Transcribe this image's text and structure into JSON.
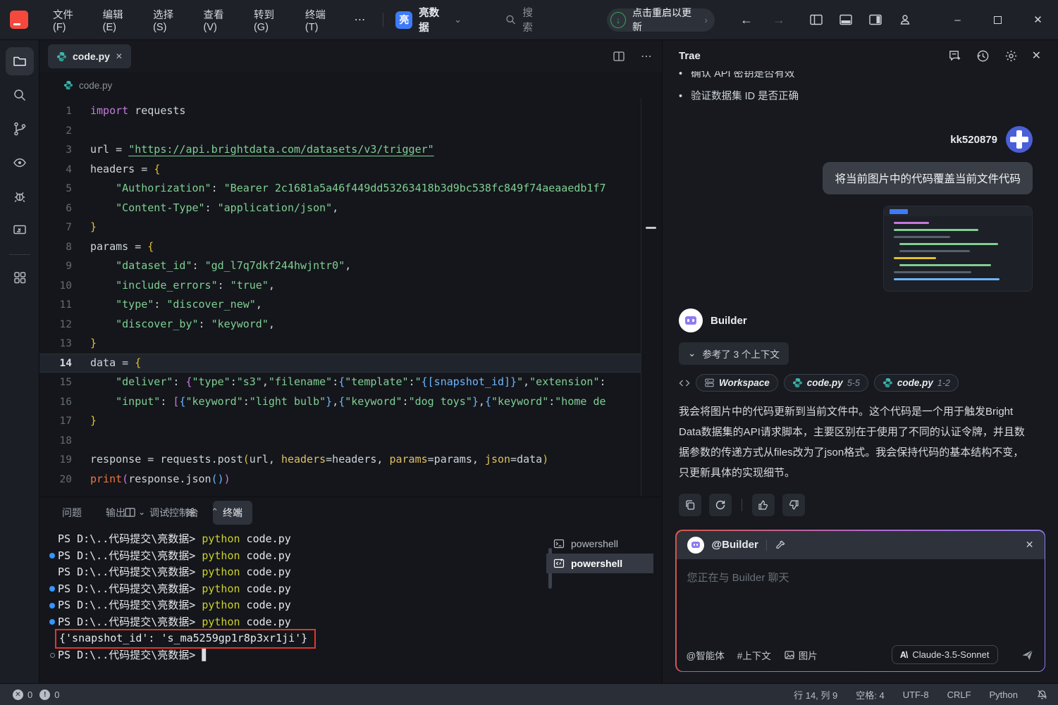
{
  "icons": {
    "close": "✕",
    "more": "⋯",
    "chevron_down": "⌄",
    "chevron_right": "›",
    "chevron_up": "⌃",
    "back": "←",
    "forward": "→",
    "minimize": "–",
    "down_arrow": "↓",
    "cursor": "▋",
    "divider": "|"
  },
  "titlebar": {
    "menus": [
      "文件(F)",
      "编辑(E)",
      "选择(S)",
      "查看(V)",
      "转到(G)",
      "终端(T)"
    ],
    "project_badge": "亮",
    "project_name": "亮数据",
    "search_label": "搜索",
    "update_label": "点击重启以更新"
  },
  "editor": {
    "tab_label": "code.py",
    "breadcrumb": "code.py",
    "lines": [
      {
        "n": 1,
        "segs": [
          [
            "kw",
            "import"
          ],
          [
            "pl",
            " requests"
          ]
        ]
      },
      {
        "n": 2,
        "segs": []
      },
      {
        "n": 3,
        "segs": [
          [
            "pl",
            "url = "
          ],
          [
            "strU",
            "\"https://api.brightdata.com/datasets/v3/trigger\""
          ]
        ]
      },
      {
        "n": 4,
        "segs": [
          [
            "pl",
            "headers = "
          ],
          [
            "y",
            "{"
          ]
        ]
      },
      {
        "n": 5,
        "segs": [
          [
            "pl",
            "    "
          ],
          [
            "str",
            "\"Authorization\""
          ],
          [
            "pl",
            ": "
          ],
          [
            "str",
            "\"Bearer 2c1681a5a46f449dd53263418b3d9bc538fc849f74aeaaedb1f7"
          ]
        ]
      },
      {
        "n": 6,
        "segs": [
          [
            "pl",
            "    "
          ],
          [
            "str",
            "\"Content-Type\""
          ],
          [
            "pl",
            ": "
          ],
          [
            "str",
            "\"application/json\""
          ],
          [
            "pl",
            ","
          ]
        ]
      },
      {
        "n": 7,
        "segs": [
          [
            "y",
            "}"
          ]
        ]
      },
      {
        "n": 8,
        "segs": [
          [
            "pl",
            "params = "
          ],
          [
            "y",
            "{"
          ]
        ]
      },
      {
        "n": 9,
        "segs": [
          [
            "pl",
            "    "
          ],
          [
            "str",
            "\"dataset_id\""
          ],
          [
            "pl",
            ": "
          ],
          [
            "str",
            "\"gd_l7q7dkf244hwjntr0\""
          ],
          [
            "pl",
            ","
          ]
        ]
      },
      {
        "n": 10,
        "segs": [
          [
            "pl",
            "    "
          ],
          [
            "str",
            "\"include_errors\""
          ],
          [
            "pl",
            ": "
          ],
          [
            "str",
            "\"true\""
          ],
          [
            "pl",
            ","
          ]
        ]
      },
      {
        "n": 11,
        "segs": [
          [
            "pl",
            "    "
          ],
          [
            "str",
            "\"type\""
          ],
          [
            "pl",
            ": "
          ],
          [
            "str",
            "\"discover_new\""
          ],
          [
            "pl",
            ","
          ]
        ]
      },
      {
        "n": 12,
        "segs": [
          [
            "pl",
            "    "
          ],
          [
            "str",
            "\"discover_by\""
          ],
          [
            "pl",
            ": "
          ],
          [
            "str",
            "\"keyword\""
          ],
          [
            "pl",
            ","
          ]
        ]
      },
      {
        "n": 13,
        "segs": [
          [
            "y",
            "}"
          ]
        ]
      },
      {
        "n": 14,
        "current": true,
        "segs": [
          [
            "pl",
            "data = "
          ],
          [
            "y",
            "{"
          ]
        ]
      },
      {
        "n": 15,
        "segs": [
          [
            "pl",
            "    "
          ],
          [
            "str",
            "\"deliver\""
          ],
          [
            "pl",
            ": "
          ],
          [
            "p",
            "{"
          ],
          [
            "str",
            "\"type\""
          ],
          [
            "pl",
            ":"
          ],
          [
            "str",
            "\"s3\""
          ],
          [
            "pl",
            ","
          ],
          [
            "str",
            "\"filename\""
          ],
          [
            "pl",
            ":"
          ],
          [
            "b",
            "{"
          ],
          [
            "str",
            "\"template\""
          ],
          [
            "pl",
            ":"
          ],
          [
            "str",
            "\""
          ],
          [
            "b",
            "{[snapshot_id]}"
          ],
          [
            "str",
            "\""
          ],
          [
            "pl",
            ","
          ],
          [
            "str",
            "\"extension\""
          ],
          [
            "pl",
            ":"
          ]
        ]
      },
      {
        "n": 16,
        "segs": [
          [
            "pl",
            "    "
          ],
          [
            "str",
            "\"input\""
          ],
          [
            "pl",
            ": "
          ],
          [
            "p",
            "["
          ],
          [
            "b",
            "{"
          ],
          [
            "str",
            "\"keyword\""
          ],
          [
            "pl",
            ":"
          ],
          [
            "str",
            "\"light bulb\""
          ],
          [
            "b",
            "}"
          ],
          [
            "pl",
            ","
          ],
          [
            "b",
            "{"
          ],
          [
            "str",
            "\"keyword\""
          ],
          [
            "pl",
            ":"
          ],
          [
            "str",
            "\"dog toys\""
          ],
          [
            "b",
            "}"
          ],
          [
            "pl",
            ","
          ],
          [
            "b",
            "{"
          ],
          [
            "str",
            "\"keyword\""
          ],
          [
            "pl",
            ":"
          ],
          [
            "str",
            "\"home de"
          ]
        ]
      },
      {
        "n": 17,
        "segs": [
          [
            "y",
            "}"
          ]
        ]
      },
      {
        "n": 18,
        "segs": []
      },
      {
        "n": 19,
        "segs": [
          [
            "pl",
            "response = requests.post"
          ],
          [
            "y",
            "("
          ],
          [
            "pl",
            "url, "
          ],
          [
            "pr",
            "headers"
          ],
          [
            "pl",
            "=headers, "
          ],
          [
            "pr",
            "params"
          ],
          [
            "pl",
            "=params, "
          ],
          [
            "pr",
            "json"
          ],
          [
            "pl",
            "=data"
          ],
          [
            "y",
            ")"
          ]
        ]
      },
      {
        "n": 20,
        "segs": [
          [
            "fn",
            "print"
          ],
          [
            "p",
            "("
          ],
          [
            "pl",
            "response.json"
          ],
          [
            "b",
            "()"
          ],
          [
            "p",
            ")"
          ]
        ]
      }
    ]
  },
  "panel": {
    "tabs": [
      {
        "label": "问题",
        "active": false
      },
      {
        "label": "输出",
        "active": false
      },
      {
        "label": "调试控制台",
        "active": false
      },
      {
        "label": "终端",
        "active": true
      }
    ],
    "terminal_lines": [
      {
        "dot": "none",
        "boxed": false,
        "cursor": false,
        "segs": [
          [
            "pl",
            "PS D:\\..代码提交\\亮数据> "
          ],
          [
            "py",
            "python"
          ],
          [
            "pl",
            " code.py"
          ]
        ]
      },
      {
        "dot": "filled",
        "boxed": false,
        "cursor": false,
        "segs": [
          [
            "pl",
            "PS D:\\..代码提交\\亮数据> "
          ],
          [
            "py",
            "python"
          ],
          [
            "pl",
            " code.py"
          ]
        ]
      },
      {
        "dot": "none",
        "boxed": false,
        "cursor": false,
        "segs": [
          [
            "pl",
            "PS D:\\..代码提交\\亮数据> "
          ],
          [
            "py",
            "python"
          ],
          [
            "pl",
            " code.py"
          ]
        ]
      },
      {
        "dot": "filled",
        "boxed": false,
        "cursor": false,
        "segs": [
          [
            "pl",
            "PS D:\\..代码提交\\亮数据> "
          ],
          [
            "py",
            "python"
          ],
          [
            "pl",
            " code.py"
          ]
        ]
      },
      {
        "dot": "filled",
        "boxed": false,
        "cursor": false,
        "segs": [
          [
            "pl",
            "PS D:\\..代码提交\\亮数据> "
          ],
          [
            "py",
            "python"
          ],
          [
            "pl",
            " code.py"
          ]
        ]
      },
      {
        "dot": "filled",
        "boxed": false,
        "cursor": false,
        "segs": [
          [
            "pl",
            "PS D:\\..代码提交\\亮数据> "
          ],
          [
            "py",
            "python"
          ],
          [
            "pl",
            " code.py"
          ]
        ]
      },
      {
        "dot": "none",
        "boxed": true,
        "cursor": false,
        "segs": [
          [
            "pl",
            "{'snapshot_id': 's_ma5259gp1r8p3xr1ji'}"
          ]
        ]
      },
      {
        "dot": "hollow",
        "boxed": false,
        "cursor": true,
        "segs": [
          [
            "pl",
            "PS D:\\..代码提交\\亮数据> "
          ]
        ]
      }
    ],
    "terminal_list": [
      {
        "label": "powershell",
        "icon": "terminal-icon",
        "active": false
      },
      {
        "label": "powershell",
        "icon": "run-terminal-icon",
        "active": true
      }
    ]
  },
  "chat": {
    "title": "Trae",
    "bullets": [
      "确认 API 密钥是否有效",
      "验证数据集 ID 是否正确"
    ],
    "user_name": "kk520879",
    "user_message": "将当前图片中的代码覆盖当前文件代码",
    "assistant_name": "Builder",
    "context_toggle": "参考了 3 个上下文",
    "context_chips": [
      {
        "label": "Workspace",
        "range": "",
        "icon": "workspace-icon"
      },
      {
        "label": "code.py",
        "range": "5-5",
        "icon": "python-icon"
      },
      {
        "label": "code.py",
        "range": "1-2",
        "icon": "python-icon"
      }
    ],
    "assistant_message": "我会将图片中的代码更新到当前文件中。这个代码是一个用于触发Bright Data数据集的API请求脚本，主要区别在于使用了不同的认证令牌，并且数据参数的传递方式从files改为了json格式。我会保持代码的基本结构不变，只更新具体的实现细节。",
    "input_header": "@Builder",
    "input_placeholder": "您正在与 Builder 聊天",
    "footer_actions": [
      "@智能体",
      "#上下文",
      "图片"
    ],
    "model_logo": "A\\",
    "model_label": "Claude-3.5-Sonnet"
  },
  "statusbar": {
    "error_count": "0",
    "warning_count": "0",
    "items": [
      "行 14, 列 9",
      "空格: 4",
      "UTF-8",
      "CRLF",
      "Python"
    ]
  }
}
